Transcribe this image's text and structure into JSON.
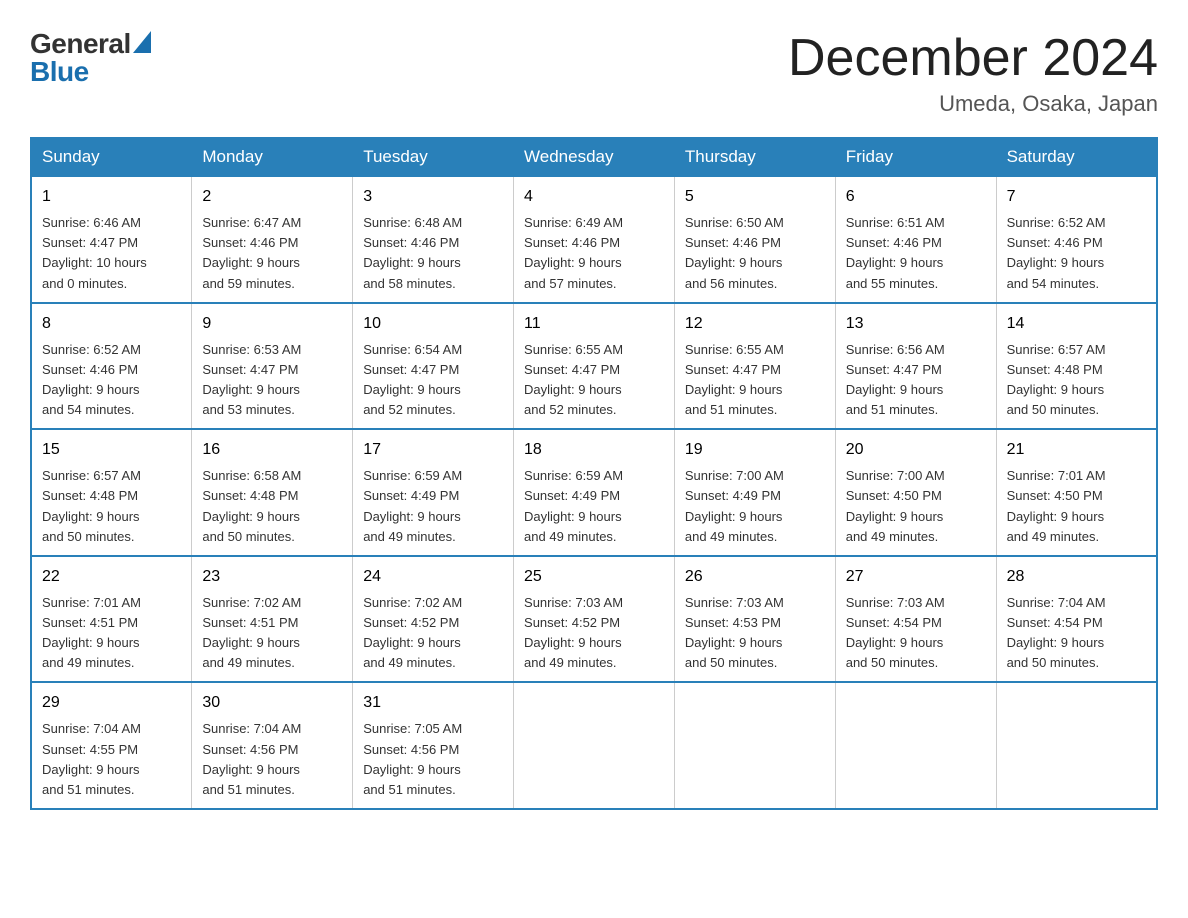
{
  "header": {
    "logo": {
      "general": "General",
      "blue": "Blue"
    },
    "title": "December 2024",
    "subtitle": "Umeda, Osaka, Japan"
  },
  "days": [
    "Sunday",
    "Monday",
    "Tuesday",
    "Wednesday",
    "Thursday",
    "Friday",
    "Saturday"
  ],
  "weeks": [
    [
      {
        "date": "1",
        "sunrise": "6:46 AM",
        "sunset": "4:47 PM",
        "daylight": "10 hours and 0 minutes."
      },
      {
        "date": "2",
        "sunrise": "6:47 AM",
        "sunset": "4:46 PM",
        "daylight": "9 hours and 59 minutes."
      },
      {
        "date": "3",
        "sunrise": "6:48 AM",
        "sunset": "4:46 PM",
        "daylight": "9 hours and 58 minutes."
      },
      {
        "date": "4",
        "sunrise": "6:49 AM",
        "sunset": "4:46 PM",
        "daylight": "9 hours and 57 minutes."
      },
      {
        "date": "5",
        "sunrise": "6:50 AM",
        "sunset": "4:46 PM",
        "daylight": "9 hours and 56 minutes."
      },
      {
        "date": "6",
        "sunrise": "6:51 AM",
        "sunset": "4:46 PM",
        "daylight": "9 hours and 55 minutes."
      },
      {
        "date": "7",
        "sunrise": "6:52 AM",
        "sunset": "4:46 PM",
        "daylight": "9 hours and 54 minutes."
      }
    ],
    [
      {
        "date": "8",
        "sunrise": "6:52 AM",
        "sunset": "4:46 PM",
        "daylight": "9 hours and 54 minutes."
      },
      {
        "date": "9",
        "sunrise": "6:53 AM",
        "sunset": "4:47 PM",
        "daylight": "9 hours and 53 minutes."
      },
      {
        "date": "10",
        "sunrise": "6:54 AM",
        "sunset": "4:47 PM",
        "daylight": "9 hours and 52 minutes."
      },
      {
        "date": "11",
        "sunrise": "6:55 AM",
        "sunset": "4:47 PM",
        "daylight": "9 hours and 52 minutes."
      },
      {
        "date": "12",
        "sunrise": "6:55 AM",
        "sunset": "4:47 PM",
        "daylight": "9 hours and 51 minutes."
      },
      {
        "date": "13",
        "sunrise": "6:56 AM",
        "sunset": "4:47 PM",
        "daylight": "9 hours and 51 minutes."
      },
      {
        "date": "14",
        "sunrise": "6:57 AM",
        "sunset": "4:48 PM",
        "daylight": "9 hours and 50 minutes."
      }
    ],
    [
      {
        "date": "15",
        "sunrise": "6:57 AM",
        "sunset": "4:48 PM",
        "daylight": "9 hours and 50 minutes."
      },
      {
        "date": "16",
        "sunrise": "6:58 AM",
        "sunset": "4:48 PM",
        "daylight": "9 hours and 50 minutes."
      },
      {
        "date": "17",
        "sunrise": "6:59 AM",
        "sunset": "4:49 PM",
        "daylight": "9 hours and 49 minutes."
      },
      {
        "date": "18",
        "sunrise": "6:59 AM",
        "sunset": "4:49 PM",
        "daylight": "9 hours and 49 minutes."
      },
      {
        "date": "19",
        "sunrise": "7:00 AM",
        "sunset": "4:49 PM",
        "daylight": "9 hours and 49 minutes."
      },
      {
        "date": "20",
        "sunrise": "7:00 AM",
        "sunset": "4:50 PM",
        "daylight": "9 hours and 49 minutes."
      },
      {
        "date": "21",
        "sunrise": "7:01 AM",
        "sunset": "4:50 PM",
        "daylight": "9 hours and 49 minutes."
      }
    ],
    [
      {
        "date": "22",
        "sunrise": "7:01 AM",
        "sunset": "4:51 PM",
        "daylight": "9 hours and 49 minutes."
      },
      {
        "date": "23",
        "sunrise": "7:02 AM",
        "sunset": "4:51 PM",
        "daylight": "9 hours and 49 minutes."
      },
      {
        "date": "24",
        "sunrise": "7:02 AM",
        "sunset": "4:52 PM",
        "daylight": "9 hours and 49 minutes."
      },
      {
        "date": "25",
        "sunrise": "7:03 AM",
        "sunset": "4:52 PM",
        "daylight": "9 hours and 49 minutes."
      },
      {
        "date": "26",
        "sunrise": "7:03 AM",
        "sunset": "4:53 PM",
        "daylight": "9 hours and 50 minutes."
      },
      {
        "date": "27",
        "sunrise": "7:03 AM",
        "sunset": "4:54 PM",
        "daylight": "9 hours and 50 minutes."
      },
      {
        "date": "28",
        "sunrise": "7:04 AM",
        "sunset": "4:54 PM",
        "daylight": "9 hours and 50 minutes."
      }
    ],
    [
      {
        "date": "29",
        "sunrise": "7:04 AM",
        "sunset": "4:55 PM",
        "daylight": "9 hours and 51 minutes."
      },
      {
        "date": "30",
        "sunrise": "7:04 AM",
        "sunset": "4:56 PM",
        "daylight": "9 hours and 51 minutes."
      },
      {
        "date": "31",
        "sunrise": "7:05 AM",
        "sunset": "4:56 PM",
        "daylight": "9 hours and 51 minutes."
      },
      null,
      null,
      null,
      null
    ]
  ],
  "labels": {
    "sunrise": "Sunrise:",
    "sunset": "Sunset:",
    "daylight": "Daylight:"
  }
}
